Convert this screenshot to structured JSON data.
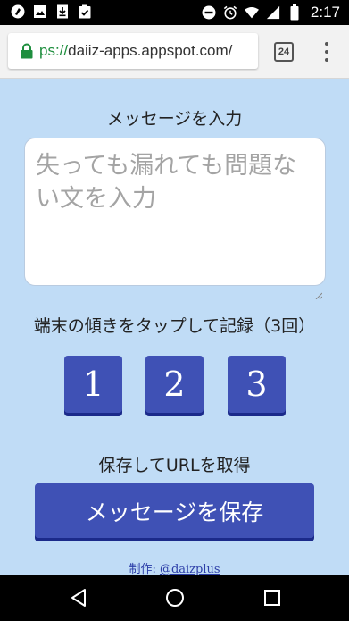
{
  "status_bar": {
    "time": "2:17",
    "left_icons": [
      "app-icon",
      "image-icon",
      "download-icon",
      "clipboard-check-icon"
    ],
    "right_icons": [
      "do-not-disturb-icon",
      "alarm-icon",
      "wifi-icon",
      "signal-icon",
      "battery-icon"
    ]
  },
  "browser": {
    "url_scheme": "ps://",
    "url_host": "daiiz-apps.appspot.com/",
    "tab_count": "24"
  },
  "page": {
    "message_label": "メッセージを入力",
    "textarea_placeholder": "失っても漏れても問題ない文を入力",
    "tilt_label": "端末の傾きをタップして記録（3回）",
    "buttons": [
      "1",
      "2",
      "3"
    ],
    "save_label": "保存してURLを取得",
    "save_button": "メッセージを保存",
    "credit_prefix": "制作: ",
    "credit_link": "@daizplus"
  },
  "colors": {
    "background": "#c0dcf6",
    "button": "#3f51b5",
    "button_shadow": "#1b2a8a",
    "lock_green": "#1e8e3e"
  }
}
